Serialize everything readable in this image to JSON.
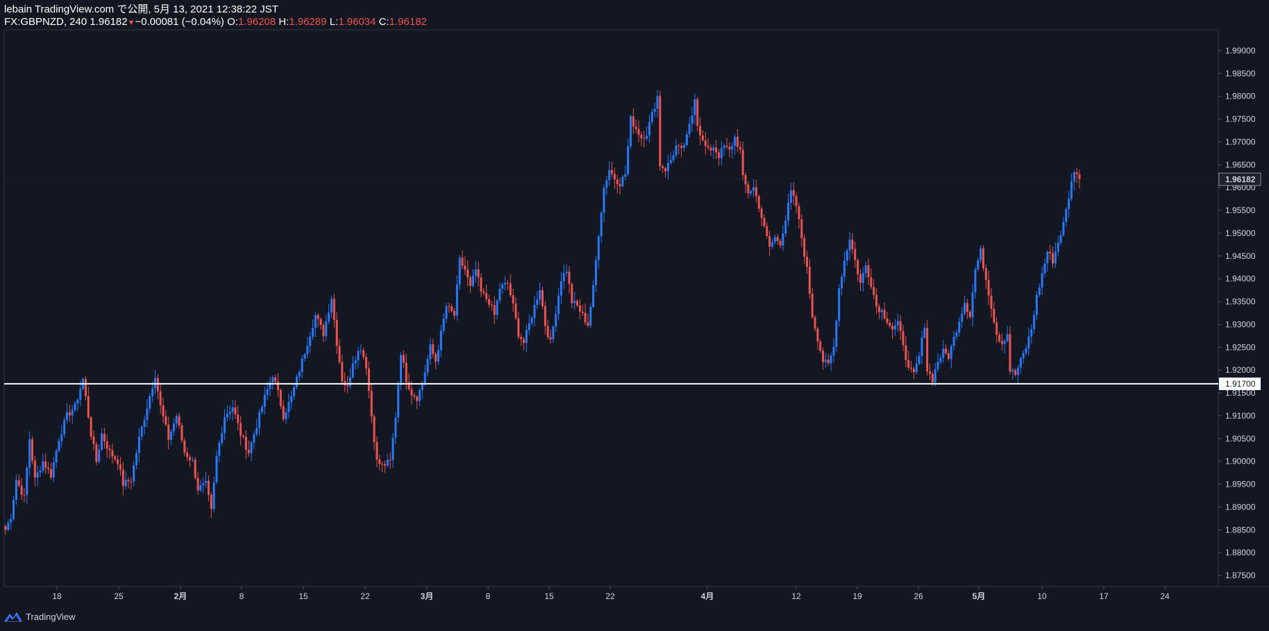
{
  "header": {
    "publisher_line": "lebain TradingView.com で公開, 5月 13, 2021 12:38:22 JST",
    "symbol_line": "FX:GBPNZD, 240 1.96182",
    "change": "−0.00081 (−0.04%)",
    "o_label": "O:",
    "o_value": "1.96208",
    "h_label": "H:",
    "h_value": "1.96289",
    "l_label": "L:",
    "l_value": "1.96034",
    "c_label": "C:",
    "c_value": "1.96182"
  },
  "footer": {
    "brand": "TradingView"
  },
  "colors": {
    "background": "#131722",
    "up": "#2979ff",
    "down": "#ef5350",
    "axis_text": "#d1d4dc",
    "horizontal_line": "#ffffff"
  },
  "chart_data": {
    "type": "candlestick",
    "symbol": "FX:GBPNZD",
    "timeframe": "240",
    "y_ticks": [
      "1.99000",
      "1.98500",
      "1.98000",
      "1.97500",
      "1.97000",
      "1.96500",
      "1.96000",
      "1.95500",
      "1.95000",
      "1.94500",
      "1.94000",
      "1.93500",
      "1.93000",
      "1.92500",
      "1.92000",
      "1.91500",
      "1.91000",
      "1.90500",
      "1.90000",
      "1.89500",
      "1.89000",
      "1.88500",
      "1.88000",
      "1.87500"
    ],
    "x_ticks": [
      {
        "label": "18",
        "bold": false
      },
      {
        "label": "25",
        "bold": false
      },
      {
        "label": "2月",
        "bold": true
      },
      {
        "label": "8",
        "bold": false
      },
      {
        "label": "15",
        "bold": false
      },
      {
        "label": "22",
        "bold": false
      },
      {
        "label": "3月",
        "bold": true
      },
      {
        "label": "8",
        "bold": false
      },
      {
        "label": "15",
        "bold": false
      },
      {
        "label": "22",
        "bold": false
      },
      {
        "label": "4月",
        "bold": true
      },
      {
        "label": "12",
        "bold": false
      },
      {
        "label": "19",
        "bold": false
      },
      {
        "label": "26",
        "bold": false
      },
      {
        "label": "5月",
        "bold": true
      },
      {
        "label": "10",
        "bold": false
      },
      {
        "label": "17",
        "bold": false
      },
      {
        "label": "24",
        "bold": false
      }
    ],
    "last_price_label": "1.96182",
    "last_price": 1.96182,
    "horizontal_line": {
      "price": 1.917,
      "label": "1.91700"
    },
    "ylim": [
      1.872,
      1.994
    ],
    "grid": false,
    "anchors": [
      [
        0,
        1.885
      ],
      [
        2,
        1.888
      ],
      [
        4,
        1.896
      ],
      [
        7,
        1.892
      ],
      [
        9,
        1.905
      ],
      [
        11,
        1.896
      ],
      [
        14,
        1.9
      ],
      [
        17,
        1.897
      ],
      [
        20,
        1.905
      ],
      [
        23,
        1.91
      ],
      [
        26,
        1.912
      ],
      [
        29,
        1.918
      ],
      [
        32,
        1.906
      ],
      [
        34,
        1.9
      ],
      [
        36,
        1.906
      ],
      [
        39,
        1.902
      ],
      [
        42,
        1.9
      ],
      [
        44,
        1.895
      ],
      [
        47,
        1.896
      ],
      [
        50,
        1.905
      ],
      [
        53,
        1.912
      ],
      [
        56,
        1.919
      ],
      [
        58,
        1.912
      ],
      [
        61,
        1.905
      ],
      [
        64,
        1.91
      ],
      [
        67,
        1.902
      ],
      [
        70,
        1.9
      ],
      [
        72,
        1.894
      ],
      [
        75,
        1.895
      ],
      [
        77,
        1.889
      ],
      [
        79,
        1.901
      ],
      [
        82,
        1.91
      ],
      [
        85,
        1.912
      ],
      [
        88,
        1.906
      ],
      [
        91,
        1.902
      ],
      [
        94,
        1.908
      ],
      [
        97,
        1.914
      ],
      [
        100,
        1.919
      ],
      [
        102,
        1.915
      ],
      [
        104,
        1.91
      ],
      [
        107,
        1.914
      ],
      [
        110,
        1.92
      ],
      [
        113,
        1.926
      ],
      [
        116,
        1.932
      ],
      [
        119,
        1.928
      ],
      [
        122,
        1.936
      ],
      [
        124,
        1.926
      ],
      [
        126,
        1.918
      ],
      [
        128,
        1.916
      ],
      [
        130,
        1.922
      ],
      [
        133,
        1.925
      ],
      [
        135,
        1.921
      ],
      [
        137,
        1.91
      ],
      [
        139,
        1.9
      ],
      [
        141,
        1.899
      ],
      [
        144,
        1.9
      ],
      [
        146,
        1.91
      ],
      [
        148,
        1.924
      ],
      [
        150,
        1.918
      ],
      [
        152,
        1.915
      ],
      [
        154,
        1.914
      ],
      [
        156,
        1.917
      ],
      [
        159,
        1.925
      ],
      [
        161,
        1.922
      ],
      [
        163,
        1.928
      ],
      [
        165,
        1.934
      ],
      [
        168,
        1.932
      ],
      [
        170,
        1.944
      ],
      [
        172,
        1.942
      ],
      [
        174,
        1.938
      ],
      [
        176,
        1.942
      ],
      [
        178,
        1.937
      ],
      [
        181,
        1.935
      ],
      [
        183,
        1.932
      ],
      [
        185,
        1.938
      ],
      [
        188,
        1.939
      ],
      [
        190,
        1.934
      ],
      [
        192,
        1.928
      ],
      [
        194,
        1.926
      ],
      [
        197,
        1.932
      ],
      [
        200,
        1.938
      ],
      [
        202,
        1.93
      ],
      [
        204,
        1.926
      ],
      [
        206,
        1.933
      ],
      [
        208,
        1.94
      ],
      [
        210,
        1.942
      ],
      [
        212,
        1.935
      ],
      [
        214,
        1.934
      ],
      [
        216,
        1.932
      ],
      [
        218,
        1.93
      ],
      [
        220,
        1.938
      ],
      [
        222,
        1.95
      ],
      [
        224,
        1.96
      ],
      [
        226,
        1.964
      ],
      [
        228,
        1.962
      ],
      [
        230,
        1.961
      ],
      [
        232,
        1.963
      ],
      [
        234,
        1.975
      ],
      [
        236,
        1.973
      ],
      [
        238,
        1.971
      ],
      [
        240,
        1.972
      ],
      [
        242,
        1.976
      ],
      [
        244,
        1.98
      ],
      [
        245,
        1.965
      ],
      [
        247,
        1.964
      ],
      [
        249,
        1.966
      ],
      [
        251,
        1.969
      ],
      [
        253,
        1.968
      ],
      [
        255,
        1.971
      ],
      [
        257,
        1.976
      ],
      [
        258,
        1.98
      ],
      [
        259,
        1.974
      ],
      [
        261,
        1.97
      ],
      [
        263,
        1.968
      ],
      [
        265,
        1.969
      ],
      [
        267,
        1.967
      ],
      [
        269,
        1.969
      ],
      [
        271,
        1.968
      ],
      [
        273,
        1.971
      ],
      [
        275,
        1.968
      ],
      [
        276,
        1.962
      ],
      [
        278,
        1.959
      ],
      [
        280,
        1.96
      ],
      [
        282,
        1.956
      ],
      [
        284,
        1.951
      ],
      [
        286,
        1.947
      ],
      [
        288,
        1.949
      ],
      [
        290,
        1.948
      ],
      [
        292,
        1.953
      ],
      [
        294,
        1.959
      ],
      [
        296,
        1.956
      ],
      [
        298,
        1.949
      ],
      [
        300,
        1.942
      ],
      [
        302,
        1.932
      ],
      [
        304,
        1.927
      ],
      [
        306,
        1.922
      ],
      [
        308,
        1.921
      ],
      [
        310,
        1.925
      ],
      [
        312,
        1.938
      ],
      [
        314,
        1.944
      ],
      [
        316,
        1.949
      ],
      [
        318,
        1.944
      ],
      [
        320,
        1.939
      ],
      [
        322,
        1.943
      ],
      [
        324,
        1.939
      ],
      [
        326,
        1.934
      ],
      [
        328,
        1.933
      ],
      [
        330,
        1.931
      ],
      [
        332,
        1.929
      ],
      [
        334,
        1.93
      ],
      [
        336,
        1.926
      ],
      [
        338,
        1.92
      ],
      [
        340,
        1.919
      ],
      [
        342,
        1.923
      ],
      [
        344,
        1.93
      ],
      [
        345,
        1.92
      ],
      [
        347,
        1.918
      ],
      [
        349,
        1.922
      ],
      [
        351,
        1.924
      ],
      [
        353,
        1.923
      ],
      [
        355,
        1.927
      ],
      [
        357,
        1.931
      ],
      [
        359,
        1.935
      ],
      [
        361,
        1.932
      ],
      [
        363,
        1.942
      ],
      [
        365,
        1.946
      ],
      [
        367,
        1.94
      ],
      [
        369,
        1.934
      ],
      [
        371,
        1.928
      ],
      [
        373,
        1.926
      ],
      [
        375,
        1.928
      ],
      [
        376,
        1.92
      ],
      [
        378,
        1.919
      ],
      [
        380,
        1.922
      ],
      [
        382,
        1.925
      ],
      [
        384,
        1.929
      ],
      [
        386,
        1.936
      ],
      [
        388,
        1.941
      ],
      [
        390,
        1.946
      ],
      [
        392,
        1.944
      ],
      [
        394,
        1.948
      ],
      [
        396,
        1.952
      ],
      [
        398,
        1.958
      ],
      [
        400,
        1.964
      ],
      [
        402,
        1.962
      ]
    ]
  }
}
